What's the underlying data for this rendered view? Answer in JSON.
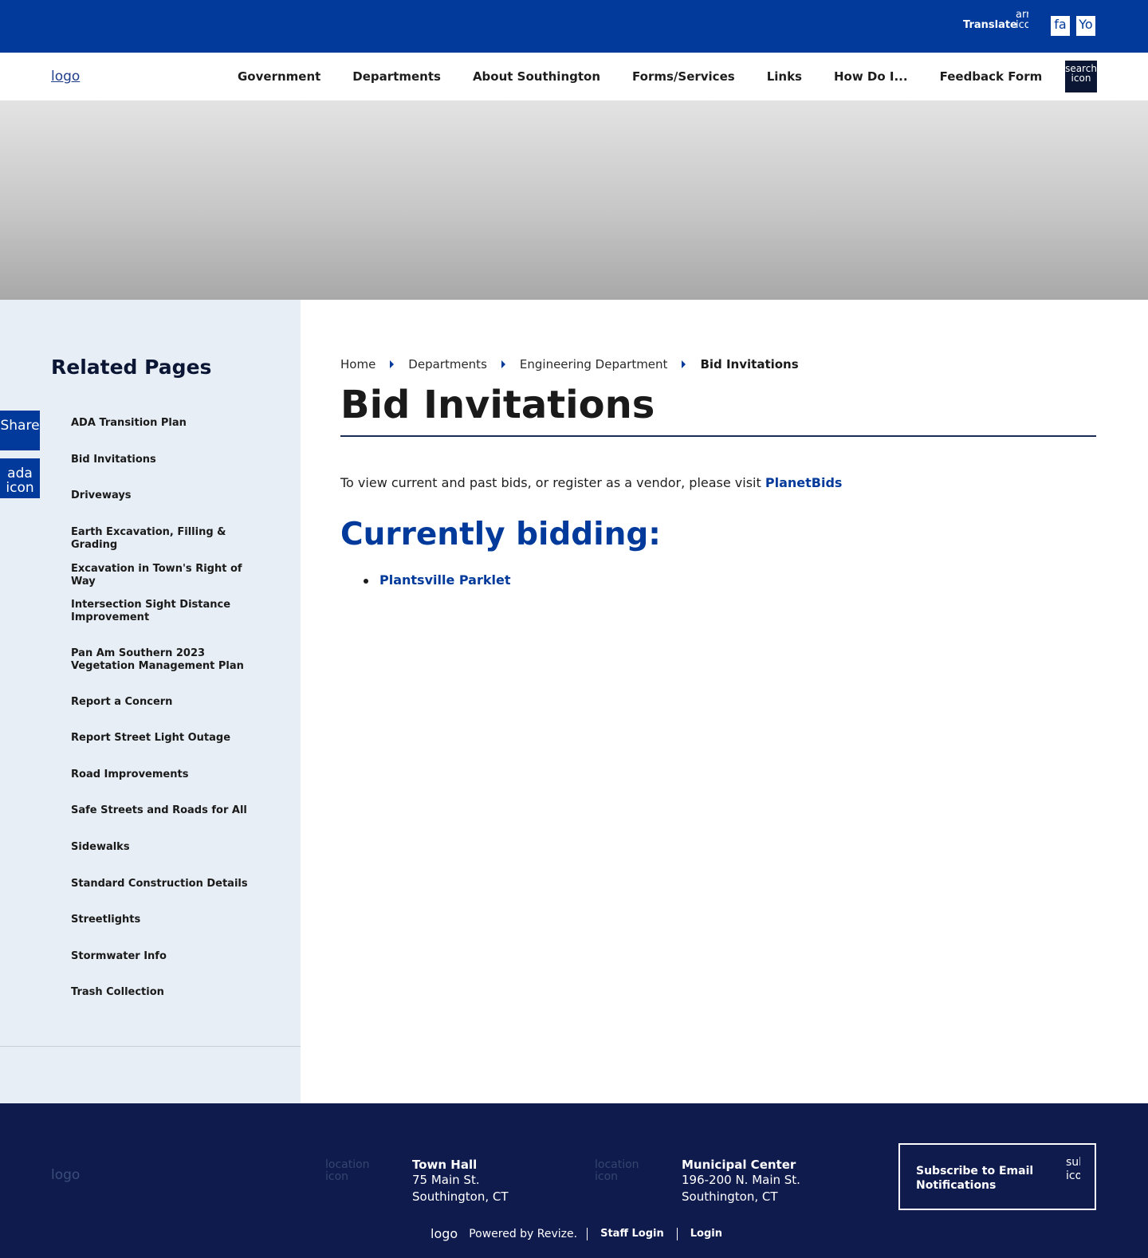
{
  "topbar": {
    "translate_label": "Translate",
    "translate_icon_alt": "arrow icon",
    "facebook_alt": "fa",
    "youtube_alt": "Yo"
  },
  "header": {
    "logo_alt": "logo",
    "search_alt": "search icon",
    "nav": [
      "Government",
      "Departments",
      "About Southington",
      "Forms/Services",
      "Links",
      "How Do I...",
      "Feedback Form"
    ]
  },
  "sidebar": {
    "title": "Related Pages",
    "items": [
      "ADA Transition Plan",
      "Bid Invitations",
      "Driveways",
      "Earth Excavation, Filling & Grading",
      "Excavation in Town's Right of Way",
      "Intersection Sight Distance Improvement",
      "Pan Am Southern 2023 Vegetation Management Plan",
      "Report a Concern",
      "Report Street Light Outage",
      "Road Improvements",
      "Safe Streets and Roads for All",
      "Sidewalks",
      "Standard Construction Details",
      "Streetlights",
      "Stormwater Info",
      "Trash Collection"
    ]
  },
  "floating": {
    "share_alt": "Share",
    "ada_alt": "ada icon"
  },
  "breadcrumb": [
    "Home",
    "Departments",
    "Engineering Department",
    "Bid Invitations"
  ],
  "content": {
    "title": "Bid Invitations",
    "intro_text": "To view current and past bids, or register as a vendor, please visit ",
    "intro_link": "PlanetBids",
    "subhead": "Currently bidding:",
    "bids": [
      "Plantsville Parklet"
    ]
  },
  "footer": {
    "logo_alt": "logo",
    "location_icon_alt": "location icon",
    "town_hall": {
      "name": "Town Hall",
      "line1": "75 Main St.",
      "line2": "Southington, CT"
    },
    "municipal": {
      "name": "Municipal Center",
      "line1": "196-200 N. Main St.",
      "line2": "Southington, CT"
    },
    "subscribe_label": "Subscribe to Email Notifications",
    "subscribe_icon_alt": "sub icon",
    "bottom_logo_alt": "logo",
    "powered": "Powered by Revize.",
    "staff_login": "Staff Login",
    "login": "Login"
  },
  "colors": {
    "brand_blue": "#013a9b",
    "footer_navy": "#0f1b4d",
    "sidebar_bg": "#e8eef5"
  }
}
